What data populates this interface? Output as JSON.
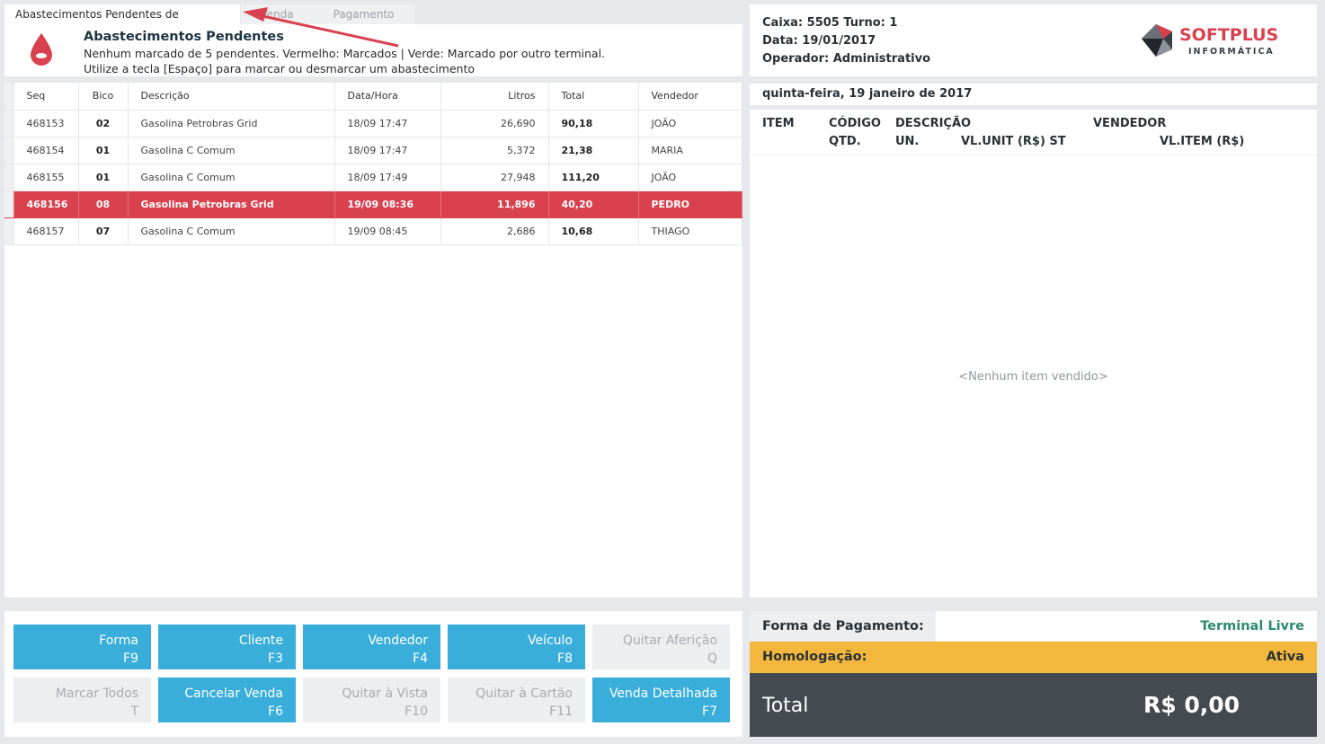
{
  "tabs": {
    "active": "Abastecimentos Pendentes de Quitação",
    "venda": "Venda",
    "pagamento": "Pagamento"
  },
  "header": {
    "title": "Abastecimentos Pendentes",
    "line1": "Nenhum marcado de 5 pendentes. Vermelho: Marcados | Verde: Marcado por outro terminal.",
    "line2": "Utilize a tecla [Espaço] para marcar ou desmarcar um abastecimento"
  },
  "grid": {
    "columns": [
      "Seq",
      "Bico",
      "Descrição",
      "Data/Hora",
      "Litros",
      "Total",
      "Vendedor"
    ],
    "rows": [
      {
        "seq": "468153",
        "bico": "02",
        "desc": "Gasolina Petrobras Grid",
        "data": "18/09 17:47",
        "litros": "26,690",
        "total": "90,18",
        "vendedor": "JOÃO"
      },
      {
        "seq": "468154",
        "bico": "01",
        "desc": "Gasolina C Comum",
        "data": "18/09 17:47",
        "litros": "5,372",
        "total": "21,38",
        "vendedor": "MARIA"
      },
      {
        "seq": "468155",
        "bico": "01",
        "desc": "Gasolina C Comum",
        "data": "18/09 17:49",
        "litros": "27,948",
        "total": "111,20",
        "vendedor": "JOÃO"
      },
      {
        "seq": "468156",
        "bico": "08",
        "desc": "Gasolina Petrobras Grid",
        "data": "19/09 08:36",
        "litros": "11,896",
        "total": "40,20",
        "vendedor": "PEDRO"
      },
      {
        "seq": "468157",
        "bico": "07",
        "desc": "Gasolina C Comum",
        "data": "19/09 08:45",
        "litros": "2,686",
        "total": "10,68",
        "vendedor": "THIAGO"
      }
    ],
    "selected_index": 3
  },
  "info": {
    "caixa": "Caixa: 5505 Turno: 1",
    "data": "Data: 19/01/2017",
    "operador": "Operador: Administrativo",
    "logo_top": "SOFTPLUS",
    "logo_bottom": "INFORMÁTICA"
  },
  "date_text": "quinta-feira, 19 janeiro de 2017",
  "items": {
    "h_item": "ITEM",
    "h_codigo": "CÓDIGO",
    "h_descricao": "DESCRIÇÃO",
    "h_vendedor": "VENDEDOR",
    "h_qtd": "QTD.",
    "h_un": "UN.",
    "h_vlunit": "VL.UNIT (R$) ST",
    "h_vlitem": "VL.ITEM (R$)",
    "empty": "<Nenhum item vendido>"
  },
  "buttons": [
    {
      "label": "Forma",
      "key": "F9",
      "enabled": true
    },
    {
      "label": "Cliente",
      "key": "F3",
      "enabled": true
    },
    {
      "label": "Vendedor",
      "key": "F4",
      "enabled": true
    },
    {
      "label": "Veículo",
      "key": "F8",
      "enabled": true
    },
    {
      "label": "Quitar Aferição",
      "key": "Q",
      "enabled": false
    },
    {
      "label": "Marcar Todos",
      "key": "T",
      "enabled": false
    },
    {
      "label": "Cancelar Venda",
      "key": "F6",
      "enabled": true
    },
    {
      "label": "Quitar à Vista",
      "key": "F10",
      "enabled": false
    },
    {
      "label": "Quitar à Cartão",
      "key": "F11",
      "enabled": false
    },
    {
      "label": "Venda Detalhada",
      "key": "F7",
      "enabled": true
    }
  ],
  "payment": {
    "forma_label": "Forma de Pagamento:",
    "status": "Terminal Livre",
    "homologacao_label": "Homologação:",
    "homologacao_value": "Ativa",
    "total_label": "Total",
    "total_value": "R$ 0,00"
  },
  "colors": {
    "accent_blue": "#3aaedb",
    "selected_red": "#d9414f",
    "homologacao_yellow": "#f2b73c",
    "total_dark": "#454a51",
    "status_green": "#2a8a6e"
  }
}
